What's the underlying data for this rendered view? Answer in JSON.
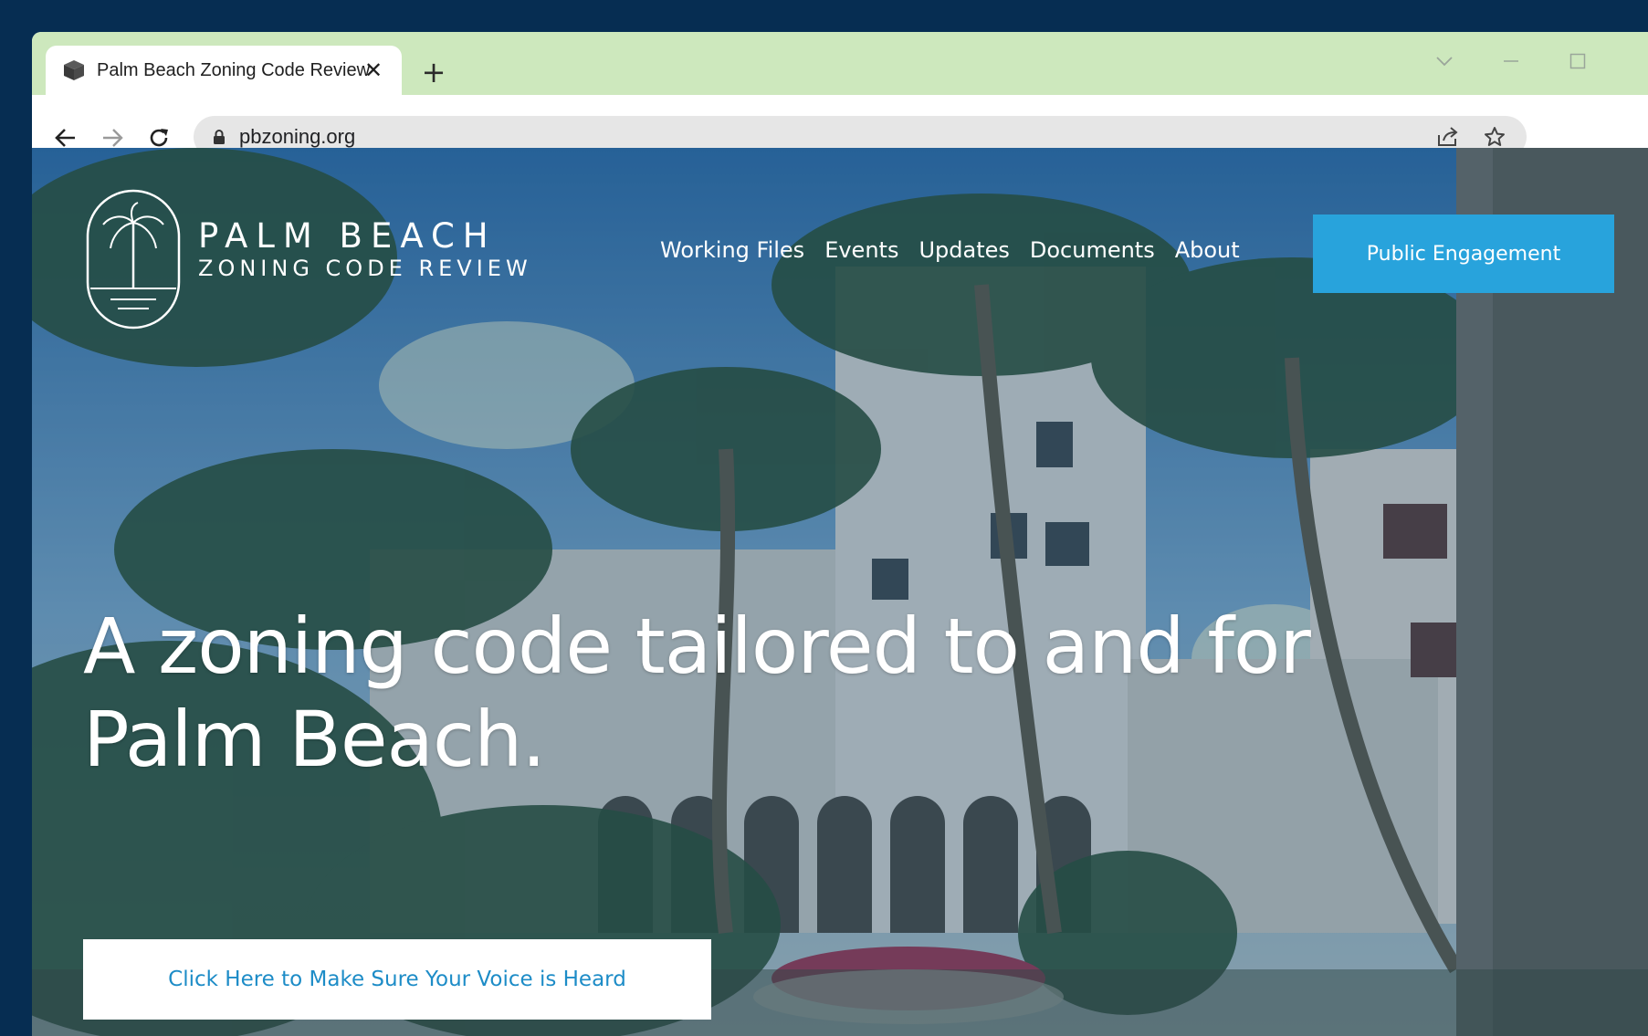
{
  "browser": {
    "tab_title": "Palm Beach Zoning Code Review",
    "tab_close_glyph": "✕",
    "new_tab_glyph": "+",
    "url": "pbzoning.org",
    "icons": [
      "back-icon",
      "forward-icon",
      "reload-icon",
      "lock-icon",
      "share-icon",
      "star-icon",
      "minimize-icon",
      "maximize-icon",
      "tab-search-icon"
    ]
  },
  "site": {
    "brand_title": "PALM BEACH",
    "brand_subtitle": "ZONING CODE REVIEW",
    "nav": [
      "Working Files",
      "Events",
      "Updates",
      "Documents",
      "About"
    ],
    "engage_button": "Public Engagement",
    "hero_line_1": "A zoning code tailored to and for",
    "hero_line_2": "Palm Beach.",
    "cta_button": "Click Here to Make Sure Your Voice is Heard",
    "colors": {
      "accent": "#28a3dc",
      "tabstrip": "#cde8bd",
      "desktop": "#062d52",
      "cta_text": "#1d8cc7"
    }
  }
}
